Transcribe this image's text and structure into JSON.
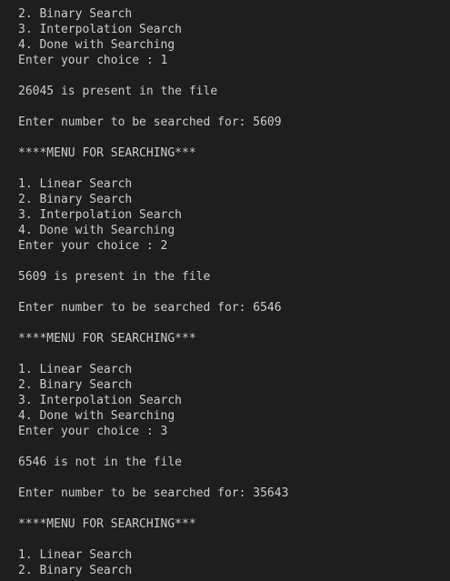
{
  "terminal": {
    "lines": [
      "2. Binary Search",
      "3. Interpolation Search",
      "4. Done with Searching",
      "Enter your choice : 1",
      "",
      "26045 is present in the file",
      "",
      "Enter number to be searched for: 5609",
      "",
      "****MENU FOR SEARCHING***",
      "",
      "1. Linear Search",
      "2. Binary Search",
      "3. Interpolation Search",
      "4. Done with Searching",
      "Enter your choice : 2",
      "",
      "5609 is present in the file",
      "",
      "Enter number to be searched for: 6546",
      "",
      "****MENU FOR SEARCHING***",
      "",
      "1. Linear Search",
      "2. Binary Search",
      "3. Interpolation Search",
      "4. Done with Searching",
      "Enter your choice : 3",
      "",
      "6546 is not in the file",
      "",
      "Enter number to be searched for: 35643",
      "",
      "****MENU FOR SEARCHING***",
      "",
      "1. Linear Search",
      "2. Binary Search"
    ]
  }
}
